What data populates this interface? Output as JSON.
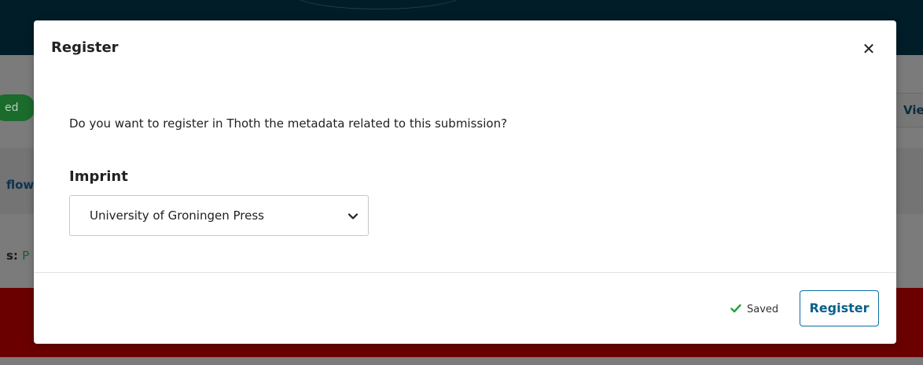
{
  "background": {
    "pill_text": "ed",
    "view_button_label": "Vie",
    "workflow_text": "flow",
    "status_label": "s:",
    "status_value": "P"
  },
  "modal": {
    "title": "Register",
    "close_icon": "close-icon",
    "question": "Do you want to register in Thoth the metadata related to this submission?",
    "imprint": {
      "label": "Imprint",
      "selected_value": "University of Groningen Press",
      "chevron_icon": "chevron-down-icon"
    },
    "footer": {
      "saved_text": "Saved",
      "saved_icon": "check-icon",
      "register_label": "Register"
    }
  },
  "colors": {
    "accent": "#0b5f89",
    "saved_check": "#22a33a",
    "header_dark": "#001d28",
    "alert_red": "#6a0000"
  }
}
